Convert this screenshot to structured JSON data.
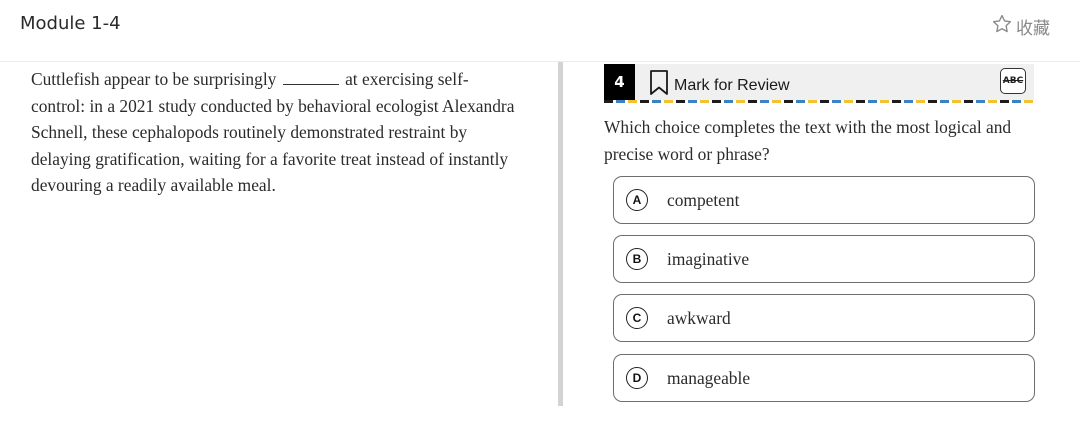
{
  "header": {
    "module_title": "Module 1-4",
    "favorite_label": "收藏",
    "favorite_icon": "star-outline-icon"
  },
  "passage": {
    "before_blank": "Cuttlefish appear to be surprisingly",
    "after_blank": "at exercising self-control: in a 2021 study conducted by behavioral ecologist Alexandra Schnell, these cephalopods routinely demonstrated restraint by delaying gratification, waiting for a favorite treat instead of instantly devouring a readily available meal."
  },
  "question": {
    "number": "4",
    "mark_label": "Mark for Review",
    "bookmark_icon": "bookmark-icon",
    "eliminator_label": "ABC",
    "prompt": "Which choice completes the text with the most logical and precise word or phrase?"
  },
  "choices": [
    {
      "letter": "A",
      "text": "competent"
    },
    {
      "letter": "B",
      "text": "imaginative"
    },
    {
      "letter": "C",
      "text": "awkward"
    },
    {
      "letter": "D",
      "text": "manageable"
    }
  ],
  "colors": {
    "dash_black": "#1c1c1c",
    "dash_blue": "#3b82c4",
    "dash_yellow": "#f2c230",
    "question_number_bg": "#000000"
  }
}
